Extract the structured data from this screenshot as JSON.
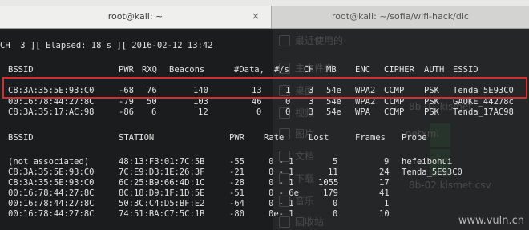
{
  "tabs": [
    {
      "title": "root@kali: ~",
      "close": "×"
    },
    {
      "title": "root@kali: ~/sofia/wifi-hack/dic"
    }
  ],
  "status_line": "CH  3 ][ Elapsed: 18 s ][ 2016-02-12 13:42",
  "ap_header": {
    "bssid": "BSSID",
    "pwr": "PWR",
    "rxq": "RXQ",
    "beacons": "Beacons",
    "data": "#Data,",
    "per_s": "#/s",
    "ch": "CH",
    "mb": "MB",
    "enc": "ENC",
    "cipher": "CIPHER",
    "auth": "AUTH",
    "essid": "ESSID"
  },
  "access_points": [
    {
      "bssid": "C8:3A:35:5E:93:C0",
      "pwr": "-68",
      "rxq": "76",
      "beacons": "140",
      "data": "13",
      "per_s": "1",
      "ch": "3",
      "mb": "54e",
      "enc": "WPA2",
      "cipher": "CCMP",
      "auth": "PSK",
      "essid": "Tenda_5E93C0"
    },
    {
      "bssid": "00:16:78:44:27:8C",
      "pwr": "-79",
      "rxq": "50",
      "beacons": "103",
      "data": "46",
      "per_s": "0",
      "ch": "3",
      "mb": "54e",
      "enc": "WPA2",
      "cipher": "CCMP",
      "auth": "PSK",
      "essid": "GAOKE_44278c"
    },
    {
      "bssid": "C8:3A:35:17:AC:98",
      "pwr": "-86",
      "rxq": "6",
      "beacons": "12",
      "data": "0",
      "per_s": "0",
      "ch": "3",
      "mb": "54e",
      "enc": "WPA",
      "cipher": "CCMP",
      "auth": "PSK",
      "essid": "Tenda_17AC98"
    }
  ],
  "station_header": {
    "bssid": "BSSID",
    "station": "STATION",
    "pwr": "PWR",
    "rate": "Rate",
    "lost": "Lost",
    "frames": "Frames",
    "probe": "Probe"
  },
  "stations": [
    {
      "bssid": "(not associated)",
      "station": "48:13:F3:01:7C:5B",
      "pwr": "-55",
      "rate": "0 - 1",
      "lost": "5",
      "frames": "9",
      "probe": "hefeibohui"
    },
    {
      "bssid": "C8:3A:35:5E:93:C0",
      "station": "7C:E9:D3:1E:26:3F",
      "pwr": "-21",
      "rate": "0 - 1",
      "lost": "11",
      "frames": "24",
      "probe": "Tenda_5E93C0"
    },
    {
      "bssid": "C8:3A:35:5E:93:C0",
      "station": "6C:25:B9:66:4D:1C",
      "pwr": "-28",
      "rate": "0 - 1",
      "lost": "1055",
      "frames": "17",
      "probe": ""
    },
    {
      "bssid": "00:16:78:44:27:8C",
      "station": "8C:18:D9:1F:1D:5E",
      "pwr": "-51",
      "rate": "0 - 6e",
      "lost": "179",
      "frames": "41",
      "probe": ""
    },
    {
      "bssid": "00:16:78:44:27:8C",
      "station": "50:3C:C4:D5:BF:E2",
      "pwr": "-64",
      "rate": "0 - 1",
      "lost": "0",
      "frames": "1",
      "probe": ""
    },
    {
      "bssid": "00:16:78:44:27:8C",
      "station": "74:51:BA:C7:5C:1B",
      "pwr": "-80",
      "rate": "0e- 1",
      "lost": "0",
      "frames": "10",
      "probe": ""
    }
  ],
  "background_window": {
    "items": [
      "最近使用的",
      "主文件夹",
      "桌面",
      "视频",
      "图片",
      "文档",
      "下载",
      "音乐",
      "回收站"
    ],
    "files": [
      "8b-01.kismet",
      "netxml",
      "8b-02.kismet.csv"
    ]
  },
  "watermark": "www.vuln.cn"
}
